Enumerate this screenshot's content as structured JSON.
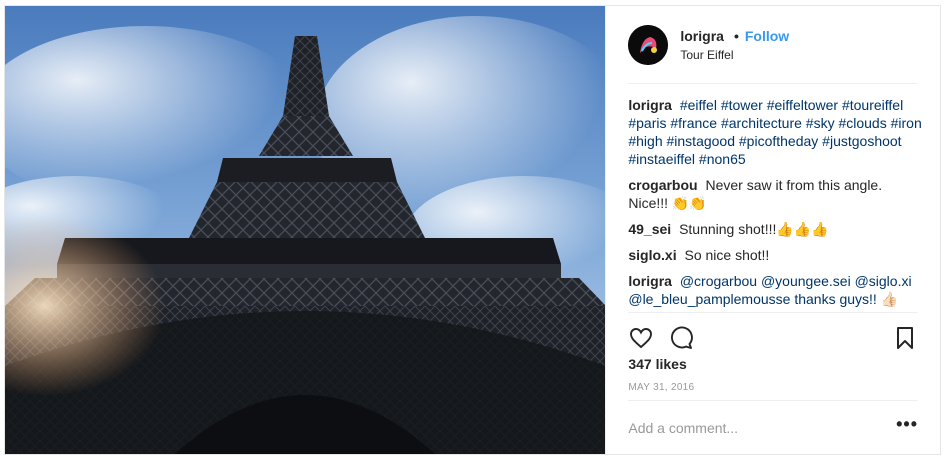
{
  "post": {
    "image_alt": "Eiffel Tower seen from below",
    "header": {
      "username": "lorigra",
      "separator": "•",
      "follow_label": "Follow",
      "location": "Tour Eiffel"
    },
    "caption": {
      "username": "lorigra",
      "text": "#eiffel #tower #eiffeltower #toureiffel #paris #france #architecture #sky #clouds #iron #high #instagood #picoftheday #justgoshoot #instaeiffel #non65"
    },
    "comments": [
      {
        "username": "crogarbou",
        "text": "Never saw it from this angle. Nice!!! 👏👏"
      },
      {
        "username": "49_sei",
        "text": "Stunning shot!!!👍👍👍"
      },
      {
        "username": "siglo.xi",
        "text": "So nice shot!!"
      },
      {
        "username": "lorigra",
        "text": "@crogarbou @youngee.sei @siglo.xi @le_bleu_pamplemousse thanks guys!! 👍🏻"
      }
    ],
    "icons": {
      "like": "heart-icon",
      "comment": "comment-icon",
      "save": "bookmark-icon",
      "more": "more-options-icon"
    },
    "likes_text": "347 likes",
    "date": "MAY 31, 2016",
    "add_comment_placeholder": "Add a comment...",
    "more_label": "•••",
    "colors": {
      "link": "#3897f0",
      "text": "#262626",
      "muted": "#999999",
      "border": "#efefef"
    }
  }
}
